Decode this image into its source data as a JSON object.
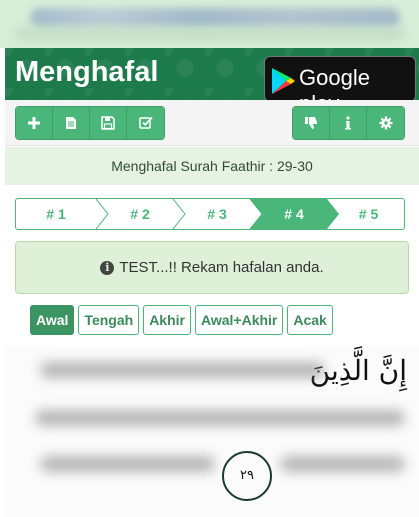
{
  "header": {
    "title": "Menghafal",
    "store_badge": "Google play"
  },
  "toolbar": {
    "left_icons": [
      "plus-icon",
      "file-icon",
      "save-icon",
      "check-square-icon"
    ],
    "right_icons": [
      "thumbs-down-icon",
      "info-icon",
      "gear-icon"
    ]
  },
  "surah_label": "Menghafal Surah Faathir : 29-30",
  "steps": [
    "# 1",
    "# 2",
    "# 3",
    "# 4",
    "# 5"
  ],
  "active_step": "# 4",
  "alert": {
    "icon": "info-circle-icon",
    "text": "TEST...!! Rekam hafalan anda."
  },
  "filters": [
    "Awal",
    "Tengah",
    "Akhir",
    "Awal+Akhir",
    "Acak"
  ],
  "active_filter": "Awal",
  "ayah": {
    "first_words": "إِنَّ الَّذِينَ",
    "number": "٢٩"
  },
  "colors": {
    "brand_green": "#1d7a4b",
    "button_green": "#4ab679",
    "active_green": "#3d9463",
    "alert_bg": "#dff0d8"
  }
}
